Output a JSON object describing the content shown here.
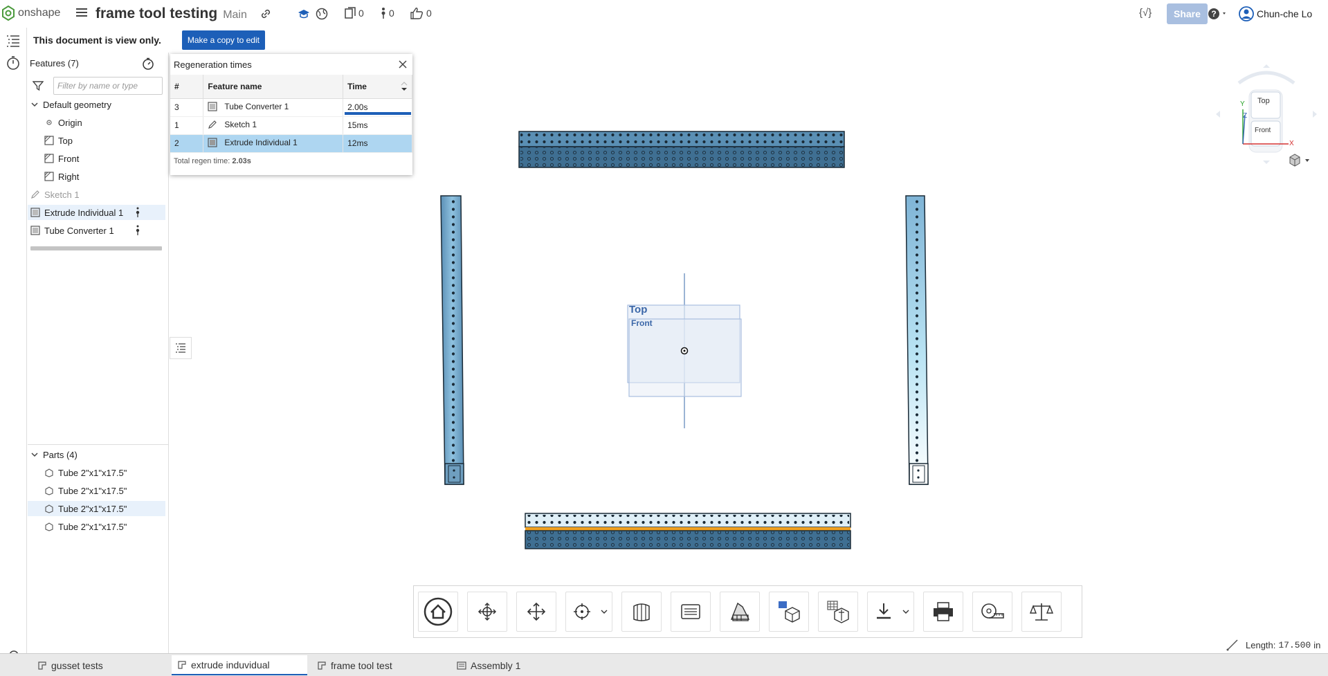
{
  "app": {
    "logo_text": "onshape",
    "document_title": "frame tool testing",
    "branch": "Main",
    "counters": {
      "versions": "0",
      "comments": "0",
      "likes": "0"
    },
    "share_label": "Share",
    "user_name": "Chun-che Lo",
    "code_icon_label": "{√}"
  },
  "notice": {
    "message": "This document is view only.",
    "copy_button": "Make a copy to edit"
  },
  "features": {
    "header": "Features (7)",
    "filter_placeholder": "Filter by name or type",
    "default_geometry": "Default geometry",
    "items": [
      "Origin",
      "Top",
      "Front",
      "Right"
    ],
    "sketch": "Sketch 1",
    "extrude": "Extrude Individual 1",
    "tube_converter": "Tube Converter 1",
    "parts_header": "Parts (4)",
    "parts": [
      "Tube 2\"x1\"x17.5\"",
      "Tube 2\"x1\"x17.5\"",
      "Tube 2\"x1\"x17.5\"",
      "Tube 2\"x1\"x17.5\""
    ]
  },
  "regen": {
    "title": "Regeneration times",
    "columns": [
      "#",
      "Feature name",
      "Time"
    ],
    "rows": [
      {
        "num": "3",
        "name": "Tube Converter 1",
        "time": "2.00s"
      },
      {
        "num": "1",
        "name": "Sketch 1",
        "time": "15ms"
      },
      {
        "num": "2",
        "name": "Extrude Individual 1",
        "time": "12ms"
      }
    ],
    "total_label": "Total regen time:",
    "total_value": "2.03s"
  },
  "viewport": {
    "plane_top": "Top",
    "plane_front": "Front",
    "cube_top": "Top",
    "cube_front": "Front",
    "axis_x": "X",
    "axis_y": "Y",
    "axis_z": "Z"
  },
  "measure": {
    "label": "Length:",
    "value": "17.500",
    "unit": "in"
  },
  "tabs": [
    "gusset tests",
    "extrude induvidual",
    "frame tool test",
    "Assembly 1"
  ],
  "colors": {
    "accent": "#1d5fb8",
    "tube": "#4d7fa3",
    "selected_row": "#aed6f1"
  }
}
